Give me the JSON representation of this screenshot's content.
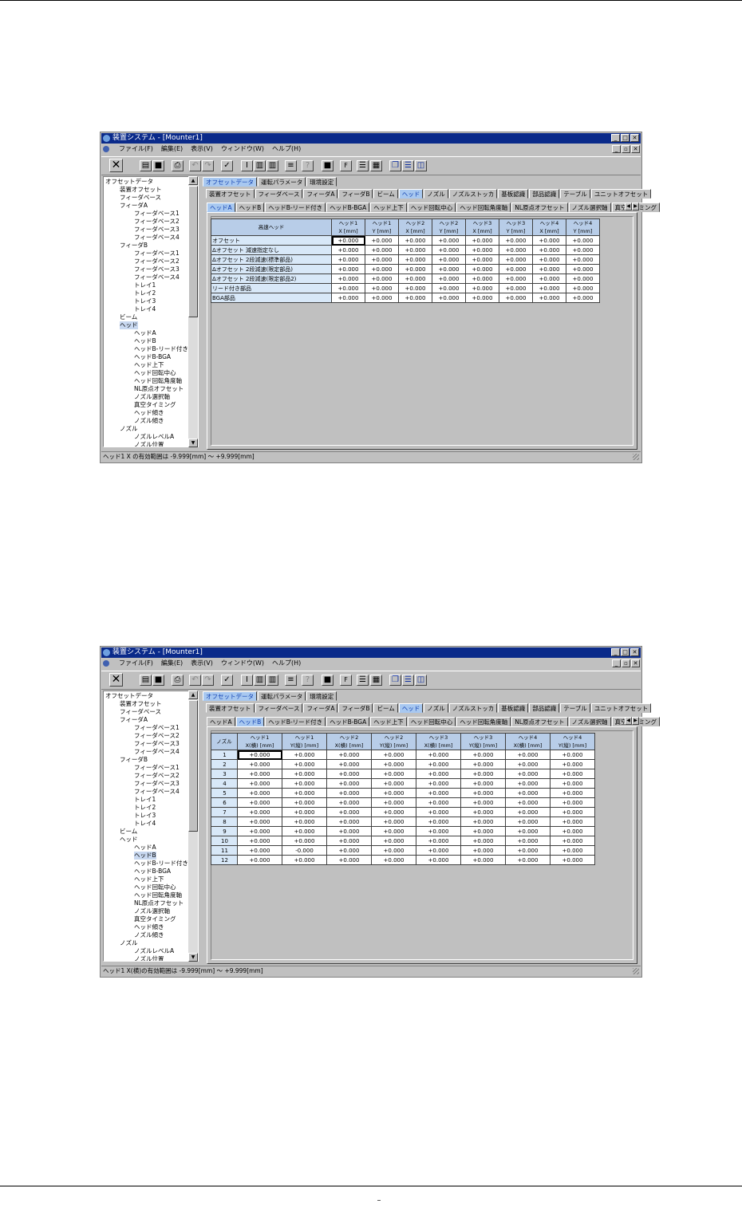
{
  "page_number": "–",
  "windows": [
    {
      "title": "装置システム - [Mounter1]",
      "menu": [
        "ファイル(F)",
        "編集(E)",
        "表示(V)",
        "ウィンドウ(W)",
        "ヘルプ(H)"
      ],
      "tree": [
        "オフセットデータ",
        "装置オフセット",
        "フィーダベース",
        "フィーダA",
        "フィーダベース1",
        "フィーダベース2",
        "フィーダベース3",
        "フィーダベース4",
        "フィーダB",
        "フィーダベース1",
        "フィーダベース2",
        "フィーダベース3",
        "フィーダベース4",
        "トレイ1",
        "トレイ2",
        "トレイ3",
        "トレイ4",
        "ビーム",
        "ヘッド",
        "ヘッドA",
        "ヘッドB",
        "ヘッドB-リード付き",
        "ヘッドB-BGA",
        "ヘッド上下",
        "ヘッド回転中心",
        "ヘッド回転角度軸",
        "NL原点オフセット",
        "ノズル選択軸",
        "真空タイミング",
        "ヘッド傾き",
        "ノズル傾き",
        "ノズル",
        "ノズルレベルA",
        "ノズル位置"
      ],
      "tabs_l1": [
        "オフセットデータ",
        "運転パラメータ",
        "環境設定"
      ],
      "tabs_l2": [
        "装置オフセット",
        "フィーダベース",
        "フィーダA",
        "フィーダB",
        "ビーム",
        "ヘッド",
        "ノズル",
        "ノズルストッカ",
        "基板認識",
        "部品認識",
        "テーブル",
        "ユニットオフセット"
      ],
      "tabs_l3": [
        "ヘッドA",
        "ヘッドB",
        "ヘッドB-リード付き",
        "ヘッドB-BGA",
        "ヘッド上下",
        "ヘッド回転中心",
        "ヘッド回転角度軸",
        "NL原点オフセット",
        "ノズル選択軸",
        "真空タイミング"
      ],
      "corner_header": "高速ヘッド",
      "col_headers": [
        [
          "ヘッド1",
          "X [mm]"
        ],
        [
          "ヘッド1",
          "Y [mm]"
        ],
        [
          "ヘッド2",
          "X [mm]"
        ],
        [
          "ヘッド2",
          "Y [mm]"
        ],
        [
          "ヘッド3",
          "X [mm]"
        ],
        [
          "ヘッド3",
          "Y [mm]"
        ],
        [
          "ヘッド4",
          "X [mm]"
        ],
        [
          "ヘッド4",
          "Y [mm]"
        ]
      ],
      "rows": [
        {
          "label": "オフセット",
          "values": [
            "+0.000",
            "+0.000",
            "+0.000",
            "+0.000",
            "+0.000",
            "+0.000",
            "+0.000",
            "+0.000"
          ]
        },
        {
          "label": "Δオフセット 減速指定なし",
          "values": [
            "+0.000",
            "+0.000",
            "+0.000",
            "+0.000",
            "+0.000",
            "+0.000",
            "+0.000",
            "+0.000"
          ]
        },
        {
          "label": "Δオフセット 2段減速(標準部品)",
          "values": [
            "+0.000",
            "+0.000",
            "+0.000",
            "+0.000",
            "+0.000",
            "+0.000",
            "+0.000",
            "+0.000"
          ]
        },
        {
          "label": "Δオフセット 2段減速(限定部品)",
          "values": [
            "+0.000",
            "+0.000",
            "+0.000",
            "+0.000",
            "+0.000",
            "+0.000",
            "+0.000",
            "+0.000"
          ]
        },
        {
          "label": "Δオフセット 2段減速(限定部品2)",
          "values": [
            "+0.000",
            "+0.000",
            "+0.000",
            "+0.000",
            "+0.000",
            "+0.000",
            "+0.000",
            "+0.000"
          ]
        },
        {
          "label": "リード付き部品",
          "values": [
            "+0.000",
            "+0.000",
            "+0.000",
            "+0.000",
            "+0.000",
            "+0.000",
            "+0.000",
            "+0.000"
          ]
        },
        {
          "label": "BGA部品",
          "values": [
            "+0.000",
            "+0.000",
            "+0.000",
            "+0.000",
            "+0.000",
            "+0.000",
            "+0.000",
            "+0.000"
          ]
        }
      ],
      "status": "ヘッド1 X の有効範囲は -9.999[mm] ～ +9.999[mm]"
    },
    {
      "title": "装置システム - [Mounter1]",
      "menu": [
        "ファイル(F)",
        "編集(E)",
        "表示(V)",
        "ウィンドウ(W)",
        "ヘルプ(H)"
      ],
      "tree": [
        "オフセットデータ",
        "装置オフセット",
        "フィーダベース",
        "フィーダA",
        "フィーダベース1",
        "フィーダベース2",
        "フィーダベース3",
        "フィーダベース4",
        "フィーダB",
        "フィーダベース1",
        "フィーダベース2",
        "フィーダベース3",
        "フィーダベース4",
        "トレイ1",
        "トレイ2",
        "トレイ3",
        "トレイ4",
        "ビーム",
        "ヘッド",
        "ヘッドA",
        "ヘッドB",
        "ヘッドB-リード付き",
        "ヘッドB-BGA",
        "ヘッド上下",
        "ヘッド回転中心",
        "ヘッド回転角度軸",
        "NL原点オフセット",
        "ノズル選択軸",
        "真空タイミング",
        "ヘッド傾き",
        "ノズル傾き",
        "ノズル",
        "ノズルレベルA",
        "ノズル位置"
      ],
      "tabs_l1": [
        "オフセットデータ",
        "運転パラメータ",
        "環境設定"
      ],
      "tabs_l2": [
        "装置オフセット",
        "フィーダベース",
        "フィーダA",
        "フィーダB",
        "ビーム",
        "ヘッド",
        "ノズル",
        "ノズルストッカ",
        "基板認識",
        "部品認識",
        "テーブル",
        "ユニットオフセット"
      ],
      "tabs_l3": [
        "ヘッドA",
        "ヘッドB",
        "ヘッドB-リード付き",
        "ヘッドB-BGA",
        "ヘッド上下",
        "ヘッド回転中心",
        "ヘッド回転角度軸",
        "NL原点オフセット",
        "ノズル選択軸",
        "真空タイミング"
      ],
      "corner_header": "ノズル",
      "col_headers": [
        [
          "ヘッド1",
          "X(横) [mm]"
        ],
        [
          "ヘッド1",
          "Y(縦) [mm]"
        ],
        [
          "ヘッド2",
          "X(横) [mm]"
        ],
        [
          "ヘッド2",
          "Y(縦) [mm]"
        ],
        [
          "ヘッド3",
          "X(横) [mm]"
        ],
        [
          "ヘッド3",
          "Y(縦) [mm]"
        ],
        [
          "ヘッド4",
          "X(横) [mm]"
        ],
        [
          "ヘッド4",
          "Y(縦) [mm]"
        ]
      ],
      "rows": [
        {
          "label": "1",
          "values": [
            "+0.000",
            "+0.000",
            "+0.000",
            "+0.000",
            "+0.000",
            "+0.000",
            "+0.000",
            "+0.000"
          ]
        },
        {
          "label": "2",
          "values": [
            "+0.000",
            "+0.000",
            "+0.000",
            "+0.000",
            "+0.000",
            "+0.000",
            "+0.000",
            "+0.000"
          ]
        },
        {
          "label": "3",
          "values": [
            "+0.000",
            "+0.000",
            "+0.000",
            "+0.000",
            "+0.000",
            "+0.000",
            "+0.000",
            "+0.000"
          ]
        },
        {
          "label": "4",
          "values": [
            "+0.000",
            "+0.000",
            "+0.000",
            "+0.000",
            "+0.000",
            "+0.000",
            "+0.000",
            "+0.000"
          ]
        },
        {
          "label": "5",
          "values": [
            "+0.000",
            "+0.000",
            "+0.000",
            "+0.000",
            "+0.000",
            "+0.000",
            "+0.000",
            "+0.000"
          ]
        },
        {
          "label": "6",
          "values": [
            "+0.000",
            "+0.000",
            "+0.000",
            "+0.000",
            "+0.000",
            "+0.000",
            "+0.000",
            "+0.000"
          ]
        },
        {
          "label": "7",
          "values": [
            "+0.000",
            "+0.000",
            "+0.000",
            "+0.000",
            "+0.000",
            "+0.000",
            "+0.000",
            "+0.000"
          ]
        },
        {
          "label": "8",
          "values": [
            "+0.000",
            "+0.000",
            "+0.000",
            "+0.000",
            "+0.000",
            "+0.000",
            "+0.000",
            "+0.000"
          ]
        },
        {
          "label": "9",
          "values": [
            "+0.000",
            "+0.000",
            "+0.000",
            "+0.000",
            "+0.000",
            "+0.000",
            "+0.000",
            "+0.000"
          ]
        },
        {
          "label": "10",
          "values": [
            "+0.000",
            "+0.000",
            "+0.000",
            "+0.000",
            "+0.000",
            "+0.000",
            "+0.000",
            "+0.000"
          ]
        },
        {
          "label": "11",
          "values": [
            "+0.000",
            "-0.000",
            "+0.000",
            "+0.000",
            "+0.000",
            "+0.000",
            "+0.000",
            "+0.000"
          ]
        },
        {
          "label": "12",
          "values": [
            "+0.000",
            "+0.000",
            "+0.000",
            "+0.000",
            "+0.000",
            "+0.000",
            "+0.000",
            "+0.000"
          ]
        }
      ],
      "status": "ヘッド1 X(横)の有効範囲は -9.999[mm] ～ +9.999[mm]"
    }
  ]
}
